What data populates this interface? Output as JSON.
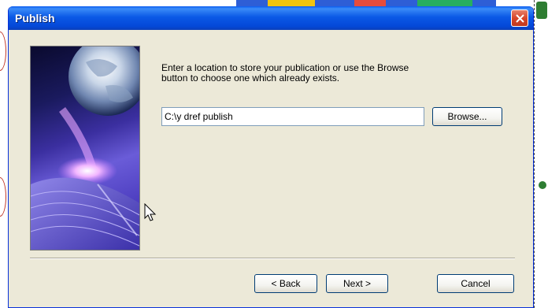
{
  "window": {
    "title": "Publish"
  },
  "instructions": {
    "line1": "Enter a location to store your publication or use the Browse",
    "line2": "button to choose one which already exists."
  },
  "location": {
    "value": "C:\\y dref publish"
  },
  "buttons": {
    "browse": "Browse...",
    "back": "< Back",
    "next": "Next >",
    "cancel": "Cancel"
  },
  "icons": {
    "close": "close-icon",
    "cursor": "mouse-pointer-icon",
    "side_image": "globe-book-illustration"
  },
  "colors": {
    "titlebar": "#0b59e6",
    "window_bg": "#ece9d8",
    "close_button": "#d8462a",
    "button_border": "#003c74"
  }
}
